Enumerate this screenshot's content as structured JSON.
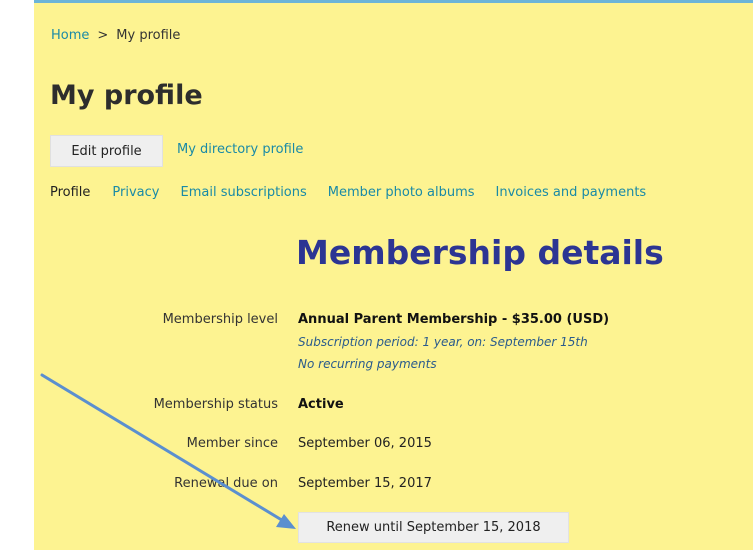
{
  "breadcrumb": {
    "home": "Home",
    "separator": ">",
    "current": "My profile"
  },
  "page": {
    "title": "My profile"
  },
  "actions": {
    "edit_profile": "Edit profile",
    "directory_profile": "My directory profile"
  },
  "tabs": [
    "Profile",
    "Privacy",
    "Email subscriptions",
    "Member photo albums",
    "Invoices and payments"
  ],
  "section": {
    "title": "Membership details"
  },
  "membership": {
    "level_label": "Membership level",
    "level_value": "Annual Parent Membership - $35.00 (USD)",
    "subscription_period": "Subscription period: 1 year, on: September 15th",
    "recurring": "No recurring payments",
    "status_label": "Membership status",
    "status_value": "Active",
    "since_label": "Member since",
    "since_value": "September 06, 2015",
    "renewal_label": "Renewal due on",
    "renewal_value": "September 15, 2017"
  },
  "renew_button": "Renew until September 15, 2018",
  "colors": {
    "panel_background": "#fdf391",
    "top_border": "#6cb4d8",
    "link": "#1a8aa6",
    "section_title": "#2c3593",
    "annotation_arrow": "#5b8fcf"
  }
}
